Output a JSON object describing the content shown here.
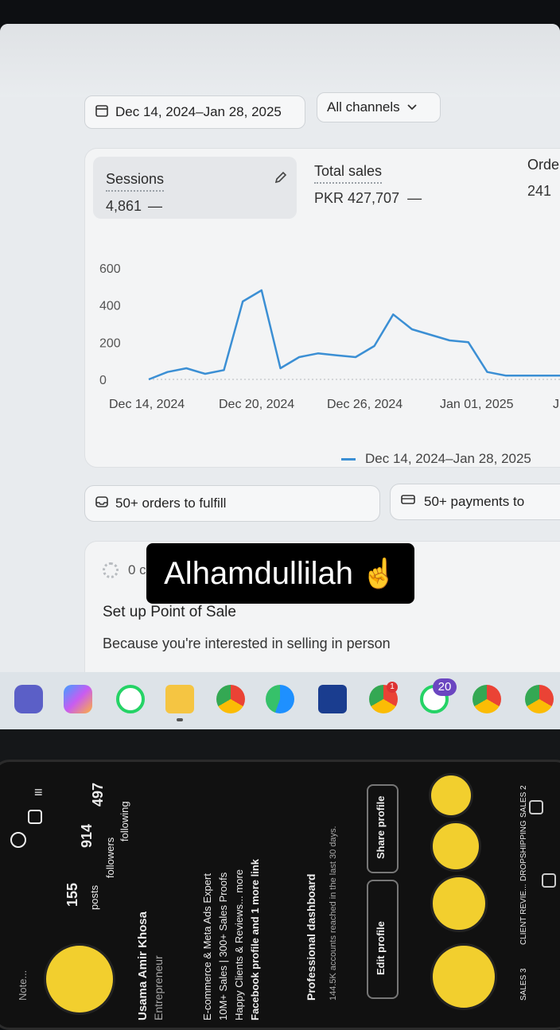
{
  "toolbar": {
    "date_range": "Dec 14, 2024–Jan 28, 2025",
    "channels": "All channels"
  },
  "metrics": [
    {
      "label": "Sessions",
      "value": "4,861",
      "trend": "—"
    },
    {
      "label": "Total sales",
      "value": "PKR 427,707",
      "trend": "—"
    },
    {
      "label": "Orde",
      "value": "241",
      "trend": ""
    }
  ],
  "chart_data": {
    "type": "line",
    "x": [
      "Dec 14, 2024",
      "Dec 15",
      "Dec 16",
      "Dec 17",
      "Dec 18",
      "Dec 19",
      "Dec 20, 2024",
      "Dec 21",
      "Dec 22",
      "Dec 23",
      "Dec 24",
      "Dec 25",
      "Dec 26, 2024",
      "Dec 27",
      "Dec 28",
      "Dec 29",
      "Dec 30",
      "Dec 31",
      "Jan 01, 2025",
      "Jan 02",
      "Jan 03",
      "Jan 04",
      "Jan 05"
    ],
    "y_ticks": [
      "600",
      "400",
      "200",
      "0"
    ],
    "x_tick_labels": [
      "Dec 14, 2024",
      "Dec 20, 2024",
      "Dec 26, 2024",
      "Jan 01, 2025",
      "J"
    ],
    "ylim": [
      0,
      600
    ],
    "series": [
      {
        "name": "Dec 14, 2024–Jan 28, 2025",
        "color": "#3b8fd4",
        "values": [
          0,
          40,
          60,
          30,
          50,
          420,
          480,
          60,
          120,
          140,
          130,
          120,
          180,
          350,
          270,
          240,
          210,
          200,
          40,
          20,
          20,
          20,
          20
        ]
      }
    ],
    "legend": "Dec 14, 2024–Jan 28, 2025"
  },
  "tasks": {
    "orders": "50+ orders to fulfill",
    "payments": "50+ payments to"
  },
  "setup": {
    "progress": "0 c",
    "title": "Set up Point of Sale",
    "subtitle": "Because you're interested in selling in person"
  },
  "caption": {
    "text": "Alhamdullilah",
    "emoji": "☝"
  },
  "taskbar": {
    "badge_whatsapp": "20",
    "badge_chrome": "1"
  },
  "phone": {
    "name": "Usama Amir Khosa",
    "role": "Entrepreneur",
    "stats": [
      {
        "value": "155",
        "label": "posts"
      },
      {
        "value": "914",
        "label": "followers"
      },
      {
        "value": "497",
        "label": "following"
      }
    ],
    "bio": [
      "E-commerce & Meta Ads Expert",
      "10M+ Sales | 300+ Sales Proofs",
      "Happy Clients & Reviews... more",
      "Facebook profile and 1 more link"
    ],
    "dashboard": "Professional dashboard",
    "dashboard_sub": "144.5K accounts reached in the last 30 days.",
    "edit": "Edit profile",
    "share": "Share profile",
    "highlights": [
      "SALES 3",
      "CLIENT REVIE...",
      "DROPSHIPPING",
      "SALES 2"
    ],
    "note": "Note..."
  }
}
